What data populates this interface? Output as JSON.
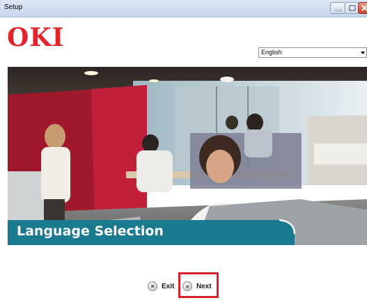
{
  "window": {
    "title": "Setup",
    "controls": [
      "minimize-icon",
      "maximize-icon",
      "close-icon"
    ]
  },
  "brand": {
    "logo_text": "OKI",
    "color": "#e0252b"
  },
  "language": {
    "selected": "English"
  },
  "banner": {
    "title": "Language Selection",
    "accent_color": "#1a7a90"
  },
  "actions": {
    "exit_label": "Exit",
    "next_label": "Next",
    "highlight_color": "#d6202a"
  }
}
